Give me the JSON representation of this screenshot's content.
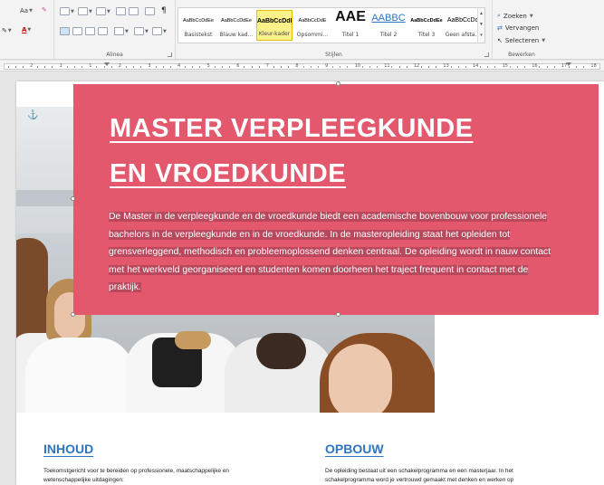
{
  "ribbon": {
    "font": {
      "grow_label": "Aa",
      "color_label": "A"
    },
    "paragraph": {
      "group_label": "Alinea"
    },
    "styles": {
      "group_label": "Stijlen",
      "items": [
        {
          "sample": "AaBbCcDdEe",
          "name": "Basistekst"
        },
        {
          "sample": "AaBbCcDdEe",
          "name": "Blauw kad..."
        },
        {
          "sample": "AaBbCcDdE",
          "name": "Kleur-kader",
          "selected": true
        },
        {
          "sample": "AaBbCcDdE",
          "name": "Opsommi..."
        },
        {
          "sample": "AAE",
          "name": "Titel 1"
        },
        {
          "sample": "AABBC",
          "name": "Titel 2"
        },
        {
          "sample": "AaBbCcDdEe",
          "name": "Titel 3"
        },
        {
          "sample": "AaBbCcDc",
          "name": "Geen afsta..."
        }
      ]
    },
    "editing": {
      "group_label": "Bewerken",
      "find_label": "Zoeken",
      "replace_label": "Vervangen",
      "select_label": "Selecteren"
    }
  },
  "ruler": {
    "numbers": [
      "2",
      "1",
      "1",
      "2",
      "3",
      "4",
      "5",
      "6",
      "7",
      "8",
      "9",
      "10",
      "11",
      "12",
      "13",
      "14",
      "15",
      "16",
      "17",
      "18"
    ]
  },
  "document": {
    "title_line1": "MASTER VERPLEEGKUNDE",
    "title_line2": "EN VROEDKUNDE",
    "intro_lines": [
      "De Master in de verpleegkunde en de vroedkunde biedt een academische bovenbouw voor professionele",
      "bachelors in de verpleegkunde en in de vroedkunde. In de masteropleiding staat het opleiden tot",
      "grensverleggend, methodisch en probleemoplossend denken centraal. De opleiding wordt in nauw contact",
      "met het werkveld georganiseerd en studenten komen doorheen het traject frequent in contact met de",
      "praktijk."
    ],
    "inhoud_heading": "INHOUD",
    "inhoud_text_line1": "Toekomstgericht voor te bereiden op professionele, maatschappelijke en",
    "inhoud_text_line2": "wetenschappelijke uitdagingen:",
    "opbouw_heading": "OPBOUW",
    "opbouw_text_line1": "De opleiding bestaat uit een schakelprogramma en een masterjaar. In het",
    "opbouw_text_line2": "schakelprogramma word je vertrouwd gemaakt met denken en werken op"
  },
  "colors": {
    "banner": "#e4586d",
    "heading_blue": "#2e74c0",
    "selected_style": "#fdf28a"
  }
}
